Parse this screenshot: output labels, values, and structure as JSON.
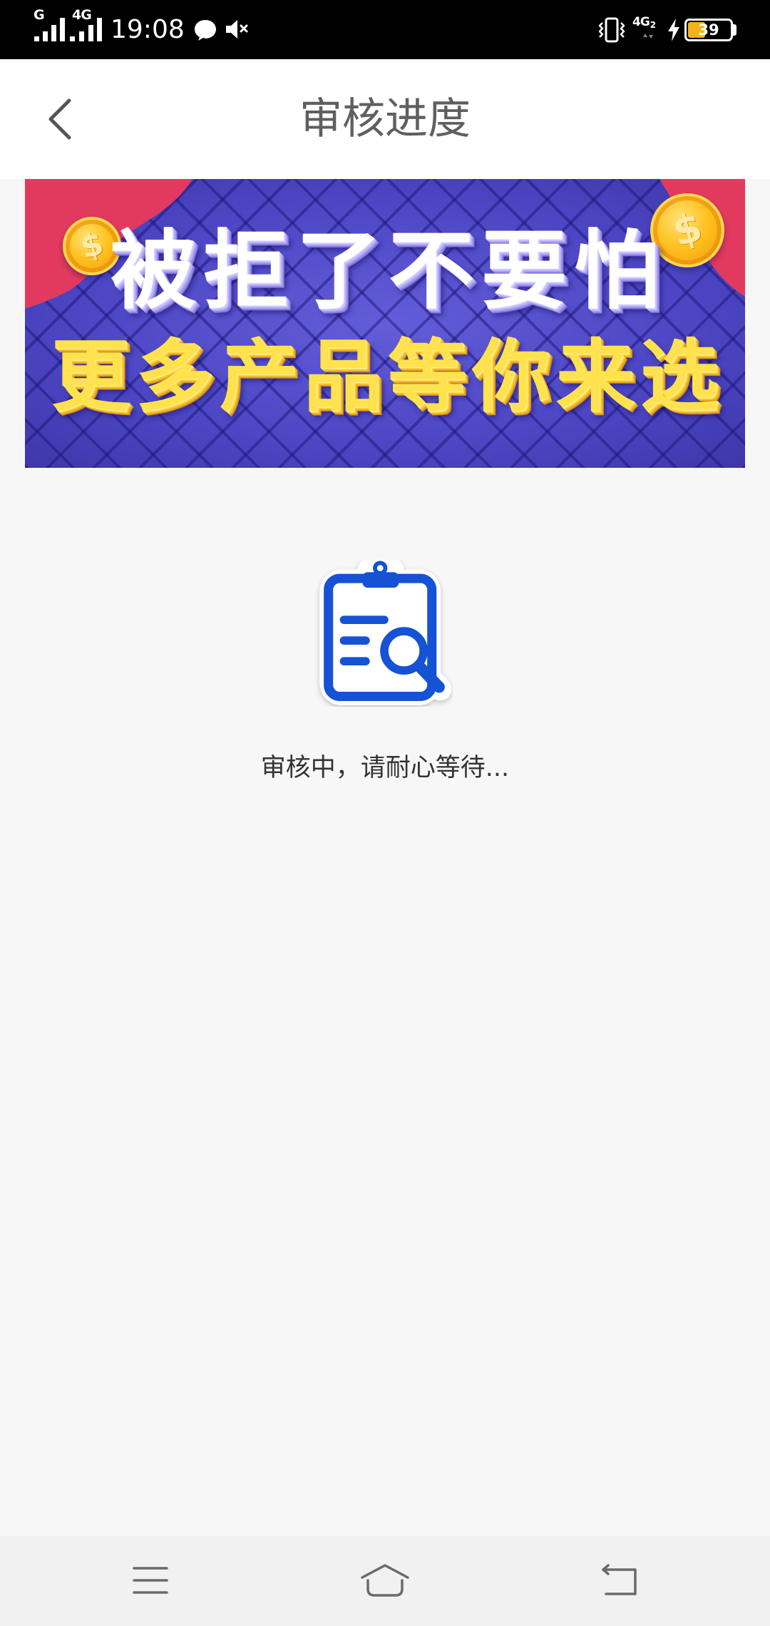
{
  "colors": {
    "status_bar_bg": "#000000",
    "page_bg": "#f7f7f7",
    "header_bg": "#ffffff",
    "accent_blue": "#1552d4",
    "banner_bg": "#4c46c4",
    "banner_red": "#e23a5e",
    "banner_yellow": "#ffe24d",
    "battery_fill": "#f5b21b",
    "nav_bar_bg": "#f1f1f1"
  },
  "status_bar": {
    "sim1_network": "G",
    "sim2_network": "4G",
    "time": "19:08",
    "data_network": "4G",
    "data_sim": "2",
    "battery_level": "39",
    "icons": {
      "sim1_signal": "signal-icon",
      "sim2_signal": "signal-icon",
      "notification": "message-icon",
      "sound": "volume-mute-icon",
      "vibrate": "vibrate-icon",
      "data_activity": "data-arrows-icon",
      "charging": "charging-bolt-icon",
      "battery": "battery-icon"
    }
  },
  "header": {
    "back_icon": "chevron-left-icon",
    "title": "审核进度"
  },
  "banner": {
    "headline": "被拒了不要怕",
    "subline": "更多产品等你来选",
    "coin_symbol": "$"
  },
  "review_status": {
    "icon": "clipboard-search-icon",
    "message": "审核中，请耐心等待..."
  },
  "nav_bar": {
    "menu_icon": "menu-icon",
    "home_icon": "home-icon",
    "back_icon": "back-icon"
  }
}
